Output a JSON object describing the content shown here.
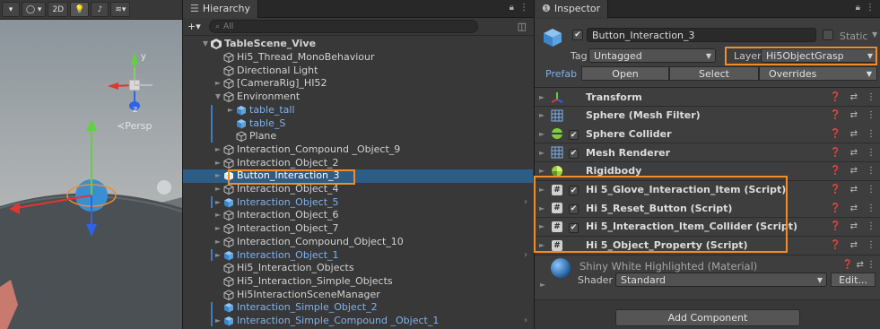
{
  "scene": {
    "toolbar_2d": "2D",
    "persp_label": "≺Persp",
    "gizmo_axis_y": "y",
    "gizmo_axis_z": "z"
  },
  "hierarchy": {
    "tab_label": "Hierarchy",
    "add_label": "+▾",
    "search_placeholder": "All",
    "rows": [
      {
        "label": "TableScene_Vive",
        "indent": 0,
        "arrow": "▼",
        "icon": "unity",
        "style": "bold"
      },
      {
        "label": "Hi5_Thread_MonoBehaviour",
        "indent": 1,
        "arrow": "",
        "icon": "cube",
        "style": ""
      },
      {
        "label": "Directional Light",
        "indent": 1,
        "arrow": "",
        "icon": "cube",
        "style": ""
      },
      {
        "label": "[CameraRig]_HI52",
        "indent": 1,
        "arrow": "►",
        "icon": "cube",
        "style": ""
      },
      {
        "label": "Environment",
        "indent": 1,
        "arrow": "▼",
        "icon": "cube",
        "style": ""
      },
      {
        "label": "table_tall",
        "indent": 2,
        "arrow": "►",
        "icon": "prefab",
        "style": "prefab"
      },
      {
        "label": "table_S",
        "indent": 2,
        "arrow": "",
        "icon": "prefab",
        "style": "prefab"
      },
      {
        "label": "Plane",
        "indent": 2,
        "arrow": "",
        "icon": "cube",
        "style": ""
      },
      {
        "label": "Interaction_Compound _Object_9",
        "indent": 1,
        "arrow": "►",
        "icon": "cube",
        "style": ""
      },
      {
        "label": "Interaction_Object_2",
        "indent": 1,
        "arrow": "►",
        "icon": "cube",
        "style": ""
      },
      {
        "label": "Button_Interaction_3",
        "indent": 1,
        "arrow": "►",
        "icon": "prefab-white",
        "style": "sel"
      },
      {
        "label": "Interaction_Object_4",
        "indent": 1,
        "arrow": "►",
        "icon": "cube",
        "style": ""
      },
      {
        "label": "Interaction_Object_5",
        "indent": 1,
        "arrow": "►",
        "icon": "prefab",
        "style": "prefab"
      },
      {
        "label": "Interaction_Object_6",
        "indent": 1,
        "arrow": "►",
        "icon": "cube",
        "style": ""
      },
      {
        "label": "Interaction_Object_7",
        "indent": 1,
        "arrow": "►",
        "icon": "cube",
        "style": ""
      },
      {
        "label": "Interaction_Compound_Object_10",
        "indent": 1,
        "arrow": "►",
        "icon": "cube",
        "style": ""
      },
      {
        "label": "Interaction_Object_1",
        "indent": 1,
        "arrow": "►",
        "icon": "prefab",
        "style": "prefab"
      },
      {
        "label": "Hi5_Interaction_Objects",
        "indent": 1,
        "arrow": "",
        "icon": "cube",
        "style": ""
      },
      {
        "label": "Hi5_Interaction_Simple_Objects",
        "indent": 1,
        "arrow": "",
        "icon": "cube",
        "style": ""
      },
      {
        "label": "Hi5InteractionSceneManager",
        "indent": 1,
        "arrow": "",
        "icon": "cube",
        "style": ""
      },
      {
        "label": "Interaction_Simple_Object_2",
        "indent": 1,
        "arrow": "",
        "icon": "prefab",
        "style": "prefab"
      },
      {
        "label": "Interaction_Simple_Compound _Object_1",
        "indent": 1,
        "arrow": "►",
        "icon": "prefab",
        "style": "prefab"
      }
    ]
  },
  "inspector": {
    "tab_label": "Inspector",
    "object_name": "Button_Interaction_3",
    "static_label": "Static",
    "tag_label": "Tag",
    "tag_value": "Untagged",
    "layer_label": "Layer",
    "layer_value": "Hi5ObjectGrasp",
    "prefab_label": "Prefab",
    "open_label": "Open",
    "select_label": "Select",
    "overrides_label": "Overrides",
    "components": [
      {
        "name": "Transform",
        "icon": "transform",
        "checkbox": false
      },
      {
        "name": "Sphere (Mesh Filter)",
        "icon": "grid",
        "checkbox": false
      },
      {
        "name": "Sphere Collider",
        "icon": "collider",
        "checkbox": true
      },
      {
        "name": "Mesh Renderer",
        "icon": "grid",
        "checkbox": true
      },
      {
        "name": "Rigidbody",
        "icon": "rigidbody",
        "checkbox": false
      },
      {
        "name": "Hi 5_Glove_Interaction_Item (Script)",
        "icon": "script",
        "checkbox": true
      },
      {
        "name": "Hi 5_Reset_Button (Script)",
        "icon": "script",
        "checkbox": true
      },
      {
        "name": "Hi 5_Interaction_Item_Collider (Script)",
        "icon": "script",
        "checkbox": true
      },
      {
        "name": "Hi 5_Object_Property (Script)",
        "icon": "script",
        "checkbox": false
      }
    ],
    "material_name": "Shiny White Highlighted (Material)",
    "shader_label": "Shader",
    "shader_value": "Standard",
    "edit_label": "Edit...",
    "add_component_label": "Add Component"
  },
  "colors": {
    "highlight": "#f08c2a",
    "selection": "#2c5d87",
    "prefab_text": "#7fb2ec"
  }
}
